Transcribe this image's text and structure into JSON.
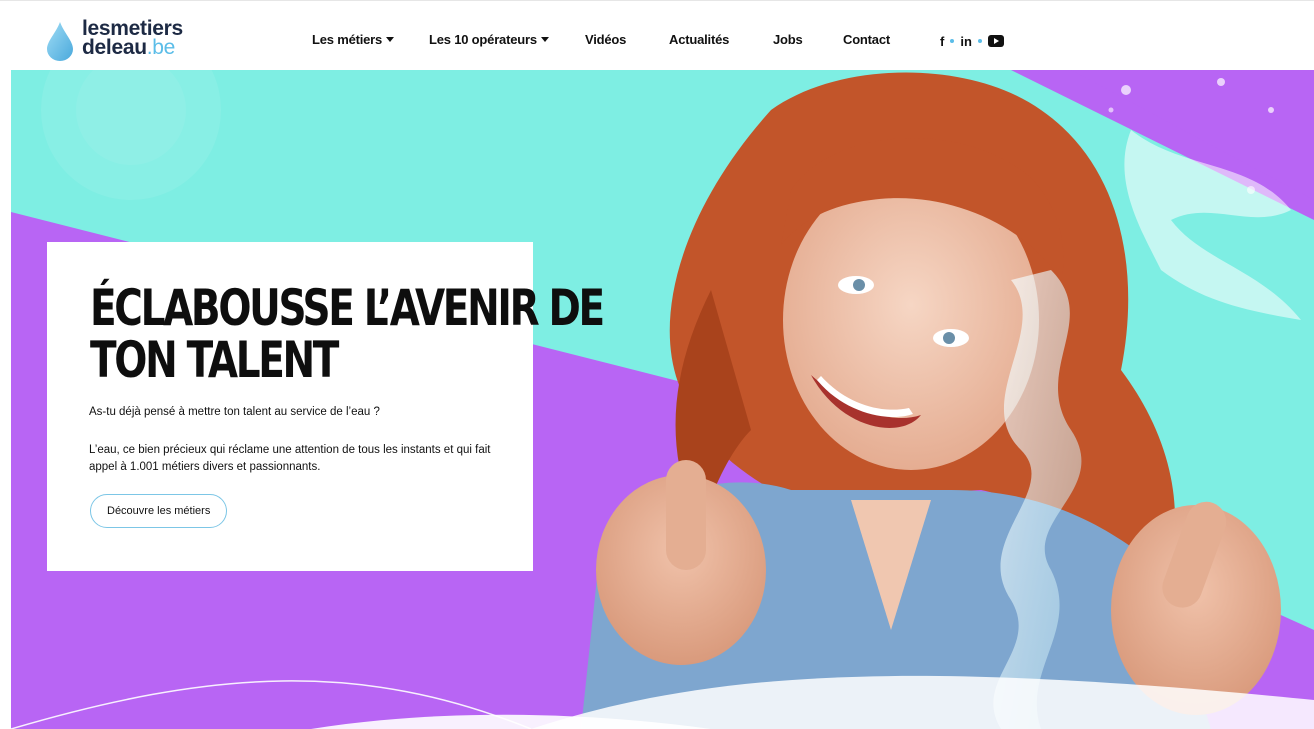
{
  "logo": {
    "line1": "lesmetiers",
    "line2": "deleau",
    "tld": ".be"
  },
  "nav": {
    "items": [
      {
        "label": "Les métiers",
        "dropdown": true
      },
      {
        "label": "Les 10 opérateurs",
        "dropdown": true
      },
      {
        "label": "Vidéos",
        "dropdown": false
      },
      {
        "label": "Actualités",
        "dropdown": false
      },
      {
        "label": "Jobs",
        "dropdown": false
      },
      {
        "label": "Contact",
        "dropdown": false
      }
    ],
    "social": {
      "facebook": "f",
      "linkedin": "in",
      "youtube_icon": "youtube-icon"
    }
  },
  "hero": {
    "headline_line1": "ÉCLABOUSSE L’AVENIR DE",
    "headline_line2": "TON TALENT",
    "intro": "As-tu déjà pensé à mettre ton talent au service de l’eau ?",
    "body": "L’eau, ce bien précieux qui réclame une attention de tous les instants et qui fait appel à 1.001 métiers divers et passionnants.",
    "cta_label": "Découvre les métiers"
  },
  "colors": {
    "brand_dark": "#1d2a44",
    "brand_light": "#5bbde8",
    "purple": "#b865f4",
    "turquoise": "#7eeee3",
    "hair": "#c2552a",
    "denim": "#7ea6cf"
  }
}
